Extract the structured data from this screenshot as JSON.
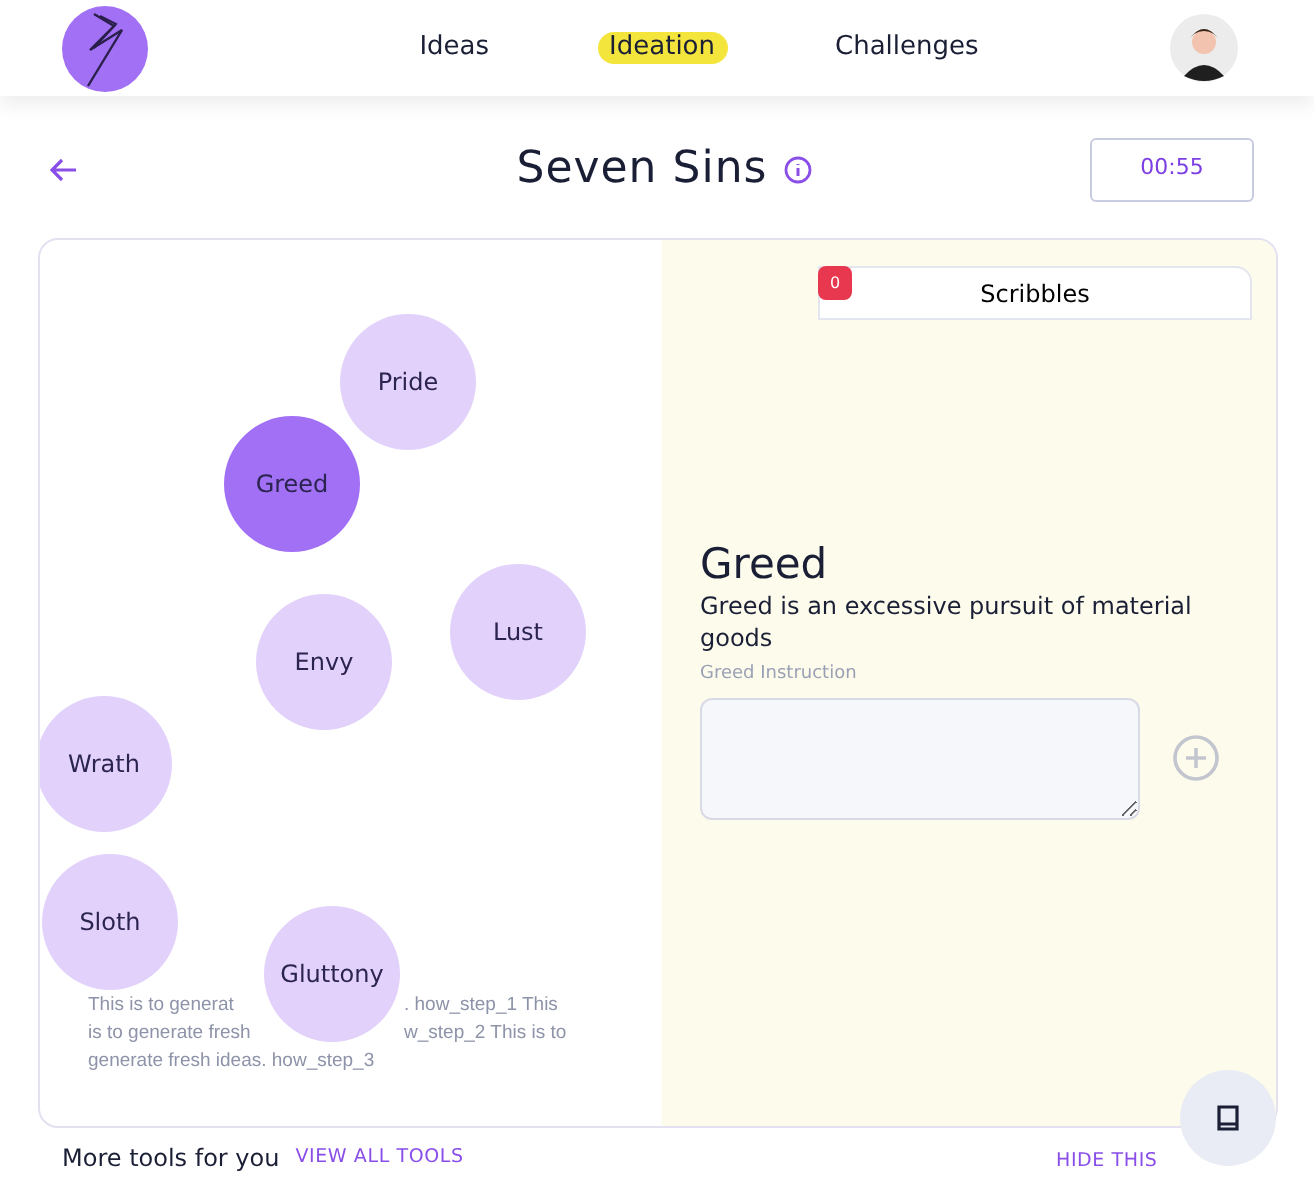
{
  "nav": {
    "links": [
      {
        "label": "Ideas",
        "selected": false
      },
      {
        "label": "Ideation",
        "selected": true
      },
      {
        "label": "Challenges",
        "selected": false
      }
    ]
  },
  "header": {
    "title": "Seven Sins",
    "timer": "00:55"
  },
  "bubbles": [
    {
      "label": "Pride",
      "selected": false
    },
    {
      "label": "Greed",
      "selected": true
    },
    {
      "label": "Lust",
      "selected": false
    },
    {
      "label": "Envy",
      "selected": false
    },
    {
      "label": "Wrath",
      "selected": false
    },
    {
      "label": "Sloth",
      "selected": false
    },
    {
      "label": "Gluttony",
      "selected": false
    }
  ],
  "steps_text": [
    [
      "This is to generat",
      ". how_step_1 This"
    ],
    [
      "is to generate fresh",
      "w_step_2 This is to"
    ],
    [
      "generate fresh ideas. how_step_3"
    ]
  ],
  "scribbles": {
    "label": "Scribbles",
    "count": "0"
  },
  "detail": {
    "title": "Greed",
    "description": "Greed is an excessive pursuit of material goods",
    "field_label": "Greed Instruction"
  },
  "footer": {
    "text": "More tools for you",
    "link": "VIEW ALL TOOLS",
    "hide": "HIDE THIS"
  }
}
